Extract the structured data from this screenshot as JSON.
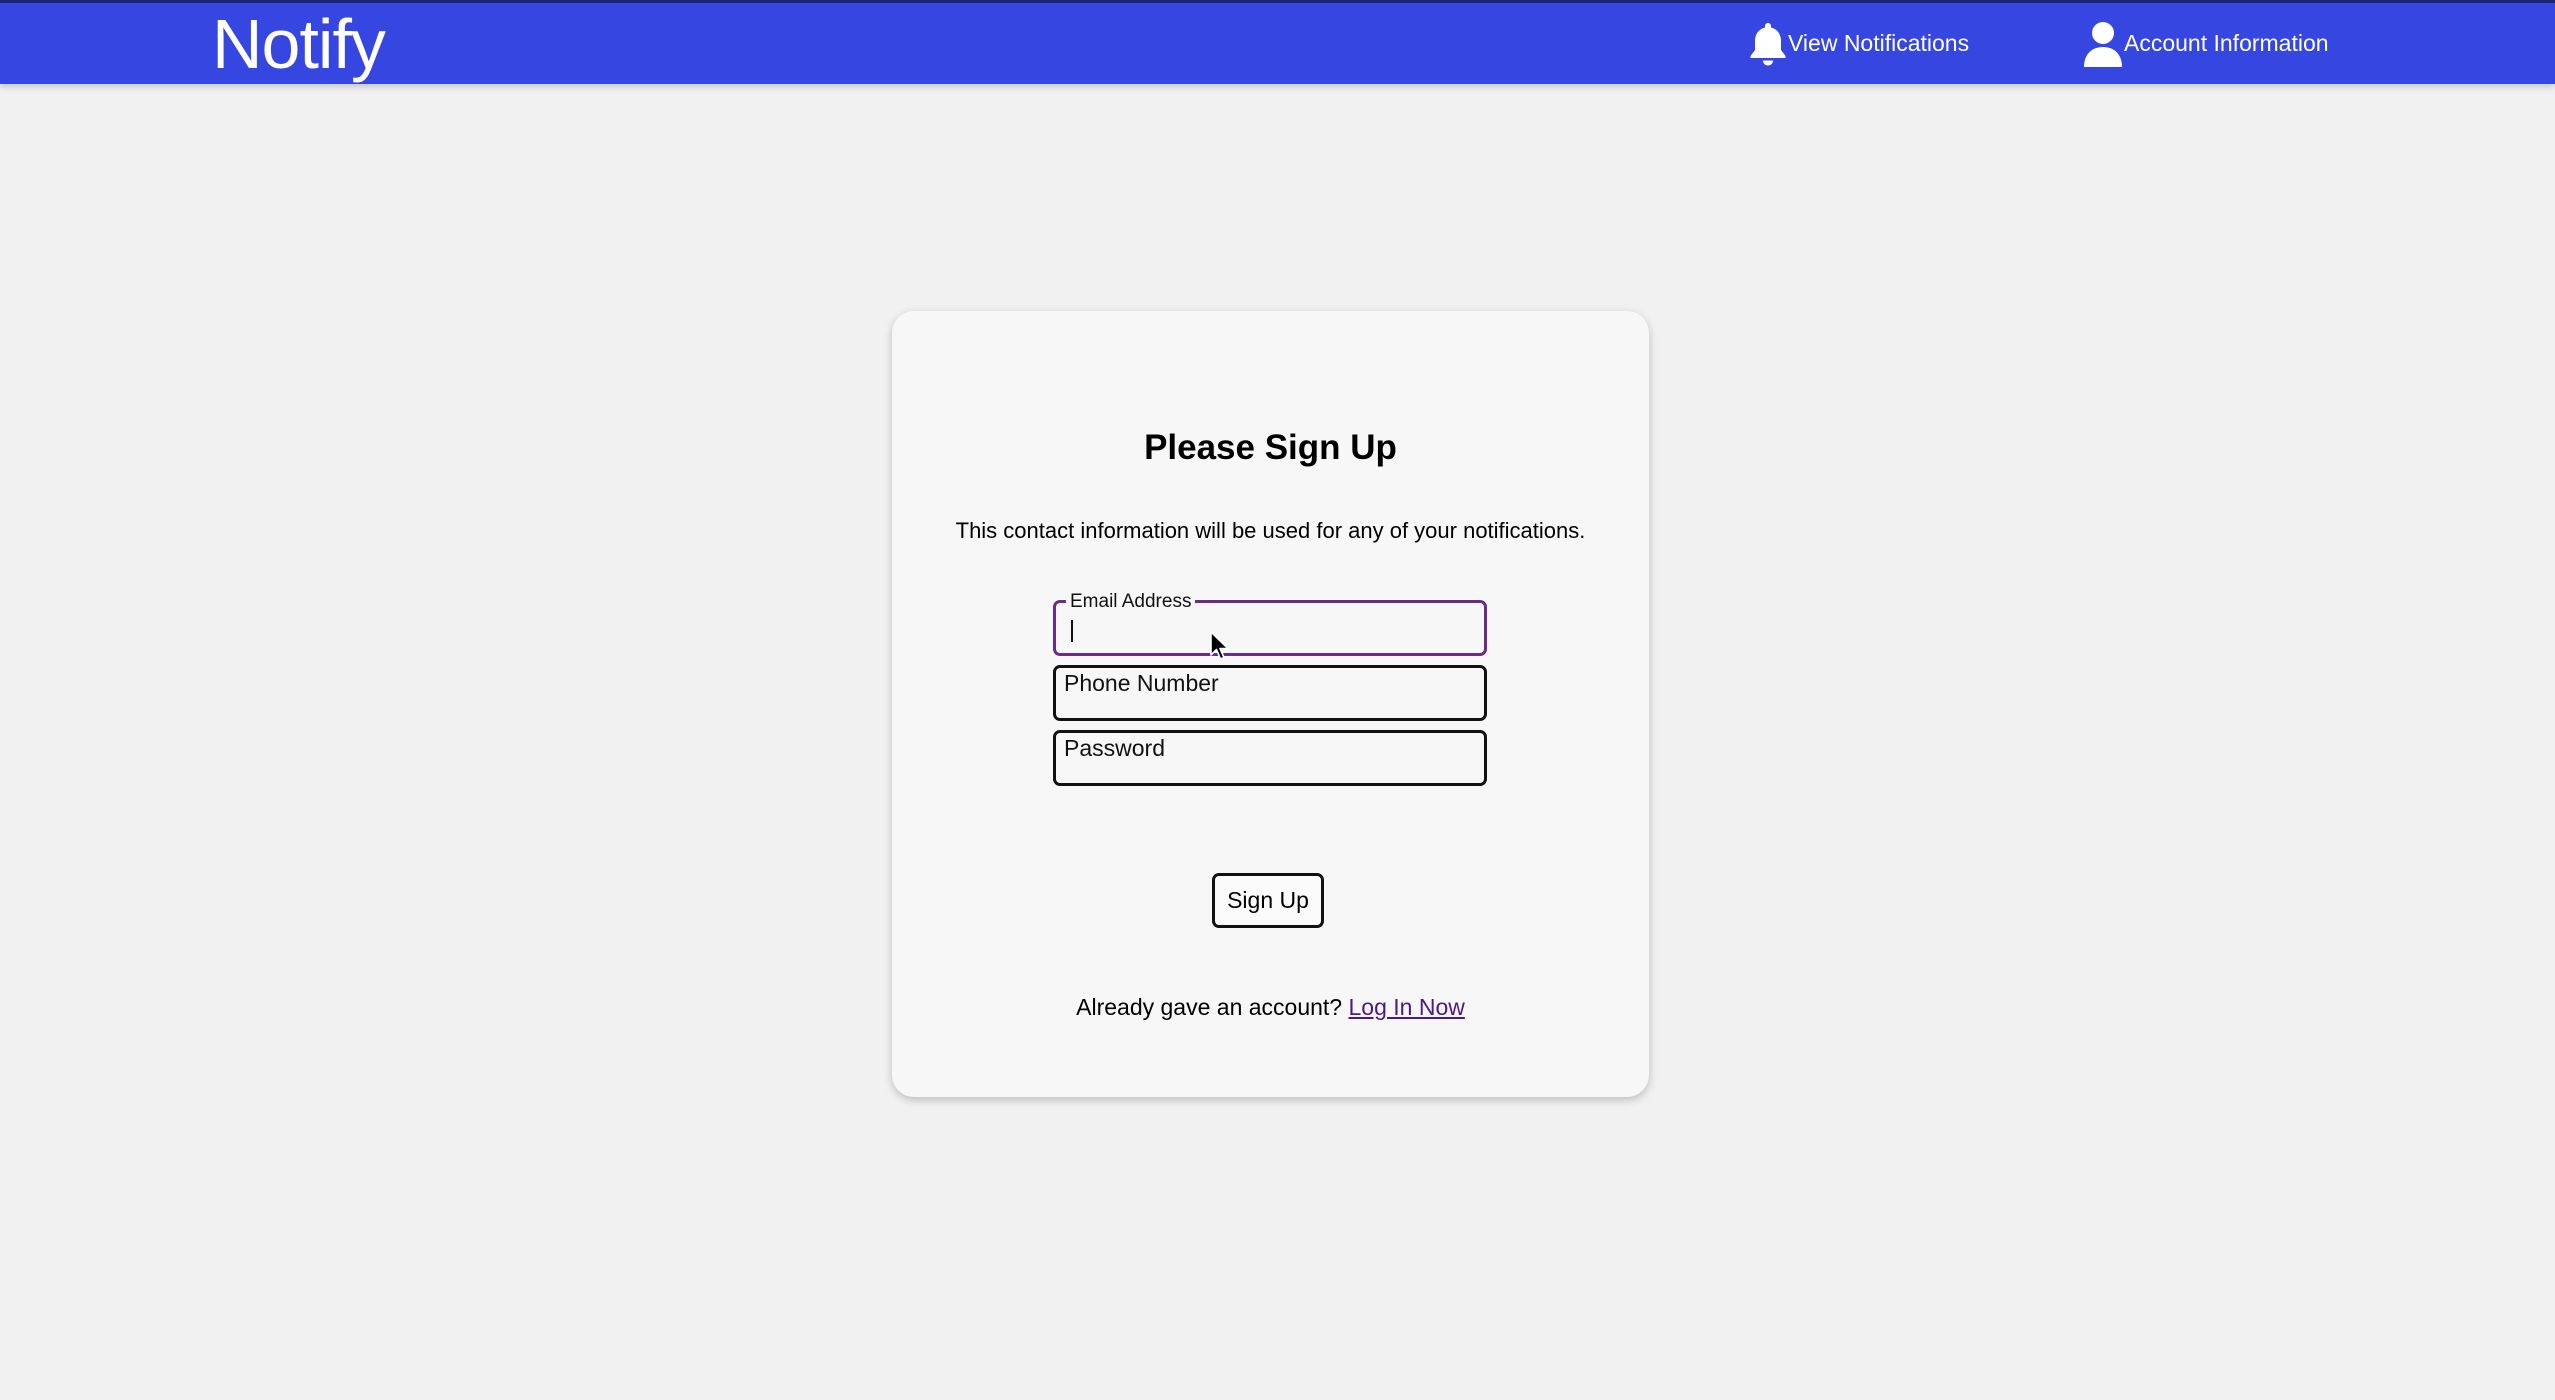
{
  "header": {
    "brand": "Notify",
    "nav": {
      "notifications_label": "View Notifications",
      "account_label": "Account Information"
    },
    "colors": {
      "bar": "#3547e0",
      "text": "#ffffff"
    }
  },
  "signup_card": {
    "title": "Please Sign Up",
    "subtitle": "This contact information will be used for any of your notifications.",
    "fields": {
      "email": {
        "label": "Email Address",
        "value": ""
      },
      "phone": {
        "placeholder": "Phone Number",
        "value": ""
      },
      "password": {
        "placeholder": "Password",
        "value": ""
      }
    },
    "submit_label": "Sign Up",
    "login_prompt": "Already gave an account?",
    "login_link": "Log In Now",
    "colors": {
      "focus_border": "#6a2c8c",
      "link": "#4b1a86"
    }
  },
  "icons": {
    "notifications": "bell-icon",
    "account": "user-icon",
    "pointer": "mouse-cursor-icon"
  }
}
